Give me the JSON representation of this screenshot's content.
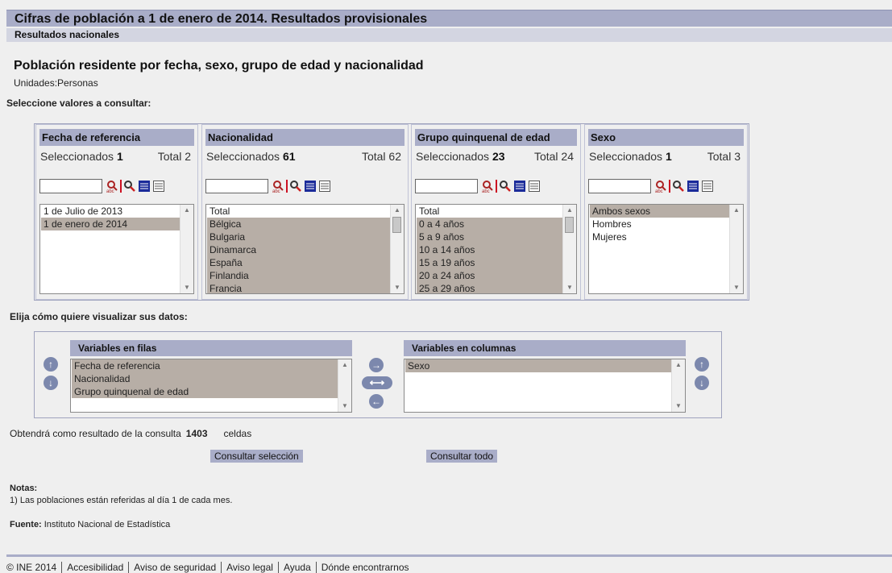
{
  "header": {
    "title": "Cifras de población a 1 de enero de 2014. Resultados provisionales",
    "subtitle": "Resultados nacionales"
  },
  "table_title": "Población residente por fecha, sexo, grupo de edad y nacionalidad",
  "units": "Unidades:Personas",
  "select_prompt": "Seleccione valores a consultar:",
  "selected_label": "Seleccionados",
  "total_label": "Total",
  "variables": [
    {
      "name": "Fecha de referencia",
      "selected": "1",
      "total": "2",
      "items": [
        "1 de Julio de 2013",
        "1 de enero de 2014"
      ],
      "selected_items": [
        1
      ]
    },
    {
      "name": "Nacionalidad",
      "selected": "61",
      "total": "62",
      "items": [
        "Total",
        "Bélgica",
        "Bulgaria",
        "Dinamarca",
        "España",
        "Finlandia",
        "Francia"
      ],
      "selected_items": [
        1,
        2,
        3,
        4,
        5,
        6
      ]
    },
    {
      "name": "Grupo quinquenal de edad",
      "selected": "23",
      "total": "24",
      "items": [
        "Total",
        "0 a 4 años",
        "5 a 9 años",
        "10 a 14 años",
        "15 a 19 años",
        "20 a 24 años",
        "25 a 29 años"
      ],
      "selected_items": [
        1,
        2,
        3,
        4,
        5,
        6
      ]
    },
    {
      "name": "Sexo",
      "selected": "1",
      "total": "3",
      "items": [
        "Ambos sexos",
        "Hombres",
        "Mujeres"
      ],
      "selected_items": [
        0
      ]
    }
  ],
  "visualize_prompt": "Elija cómo quiere visualizar sus datos:",
  "rows_panel": {
    "title": "Variables en filas",
    "items": [
      "Fecha de referencia",
      "Nacionalidad",
      "Grupo quinquenal de edad"
    ]
  },
  "cols_panel": {
    "title": "Variables en columnas",
    "items": [
      "Sexo"
    ]
  },
  "result": {
    "prefix": "Obtendrá como resultado de la consulta",
    "count": "1403",
    "suffix": "celdas"
  },
  "buttons": {
    "consult_selection": "Consultar selección",
    "consult_all": "Consultar todo"
  },
  "notes": {
    "heading": "Notas:",
    "note1": "1) Las poblaciones están referidas al día 1 de cada mes."
  },
  "source": {
    "label": "Fuente:",
    "value": "Instituto Nacional de Estadística"
  },
  "footer": [
    "© INE 2014",
    "Accesibilidad",
    "Aviso de seguridad",
    "Aviso legal",
    "Ayuda",
    "Dónde encontrarnos"
  ],
  "colors": {
    "header_bg": "#a9adc8",
    "subheader_bg": "#d3d5e1",
    "selected_item": "#b7aea6",
    "arrow_button": "#7c88ad"
  }
}
